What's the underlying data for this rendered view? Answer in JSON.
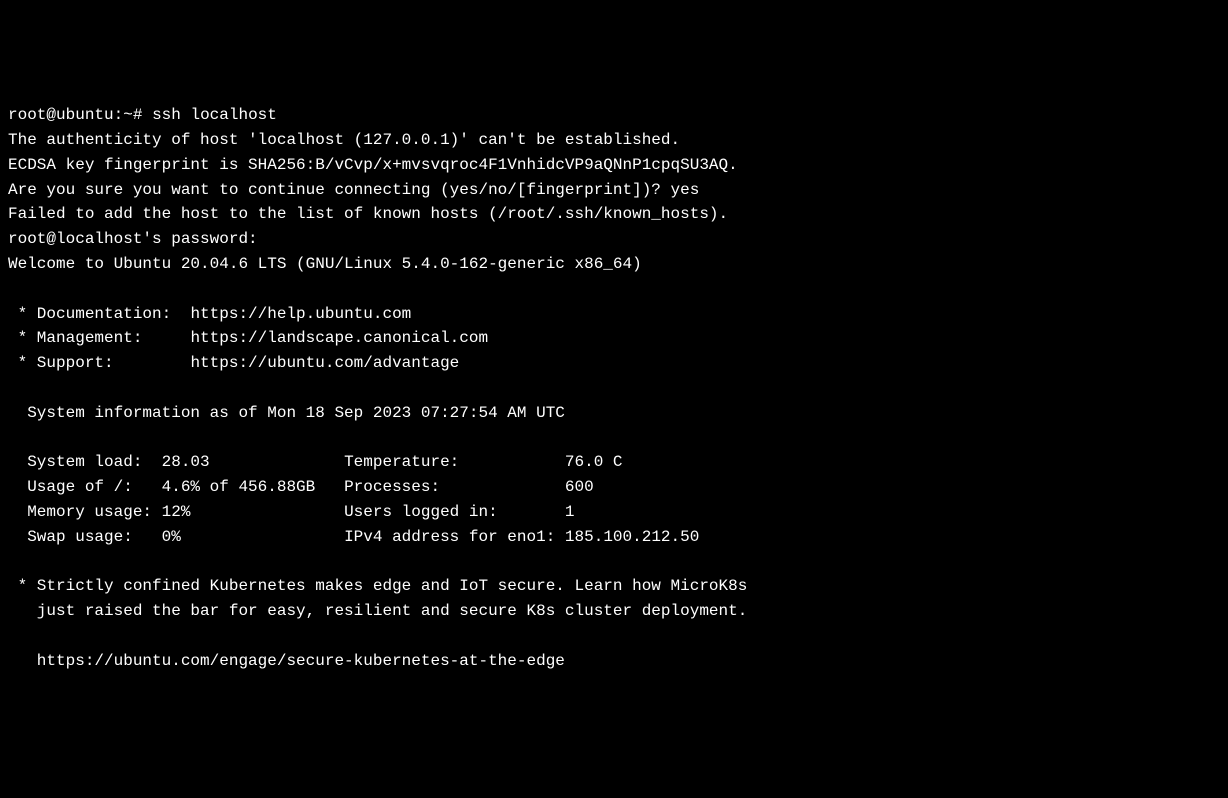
{
  "prompt": {
    "user": "root",
    "host": "ubuntu",
    "path": "~",
    "symbol": "#",
    "command": "ssh localhost"
  },
  "ssh": {
    "authenticity_line": "The authenticity of host 'localhost (127.0.0.1)' can't be established.",
    "fingerprint_line": "ECDSA key fingerprint is SHA256:B/vCvp/x+mvsvqroc4F1VnhidcVP9aQNnP1cpqSU3AQ.",
    "confirm_prompt": "Are you sure you want to continue connecting (yes/no/[fingerprint])? ",
    "confirm_answer": "yes",
    "failed_line": "Failed to add the host to the list of known hosts (/root/.ssh/known_hosts).",
    "password_prompt": "root@localhost's password:"
  },
  "welcome": "Welcome to Ubuntu 20.04.6 LTS (GNU/Linux 5.4.0-162-generic x86_64)",
  "links": {
    "doc_label": " * Documentation:  ",
    "doc_url": "https://help.ubuntu.com",
    "mgmt_label": " * Management:     ",
    "mgmt_url": "https://landscape.canonical.com",
    "support_label": " * Support:        ",
    "support_url": "https://ubuntu.com/advantage"
  },
  "sysinfo": {
    "header": "  System information as of Mon 18 Sep 2023 07:27:54 AM UTC",
    "rows": [
      {
        "left_label": "  System load:  ",
        "left_value": "28.03              ",
        "right_label": "Temperature:           ",
        "right_value": "76.0 C"
      },
      {
        "left_label": "  Usage of /:   ",
        "left_value": "4.6% of 456.88GB   ",
        "right_label": "Processes:             ",
        "right_value": "600"
      },
      {
        "left_label": "  Memory usage: ",
        "left_value": "12%                ",
        "right_label": "Users logged in:       ",
        "right_value": "1"
      },
      {
        "left_label": "  Swap usage:   ",
        "left_value": "0%                 ",
        "right_label": "IPv4 address for eno1: ",
        "right_value": "185.100.212.50"
      }
    ]
  },
  "promo": {
    "line1": " * Strictly confined Kubernetes makes edge and IoT secure. Learn how MicroK8s",
    "line2": "   just raised the bar for easy, resilient and secure K8s cluster deployment.",
    "url": "   https://ubuntu.com/engage/secure-kubernetes-at-the-edge"
  }
}
